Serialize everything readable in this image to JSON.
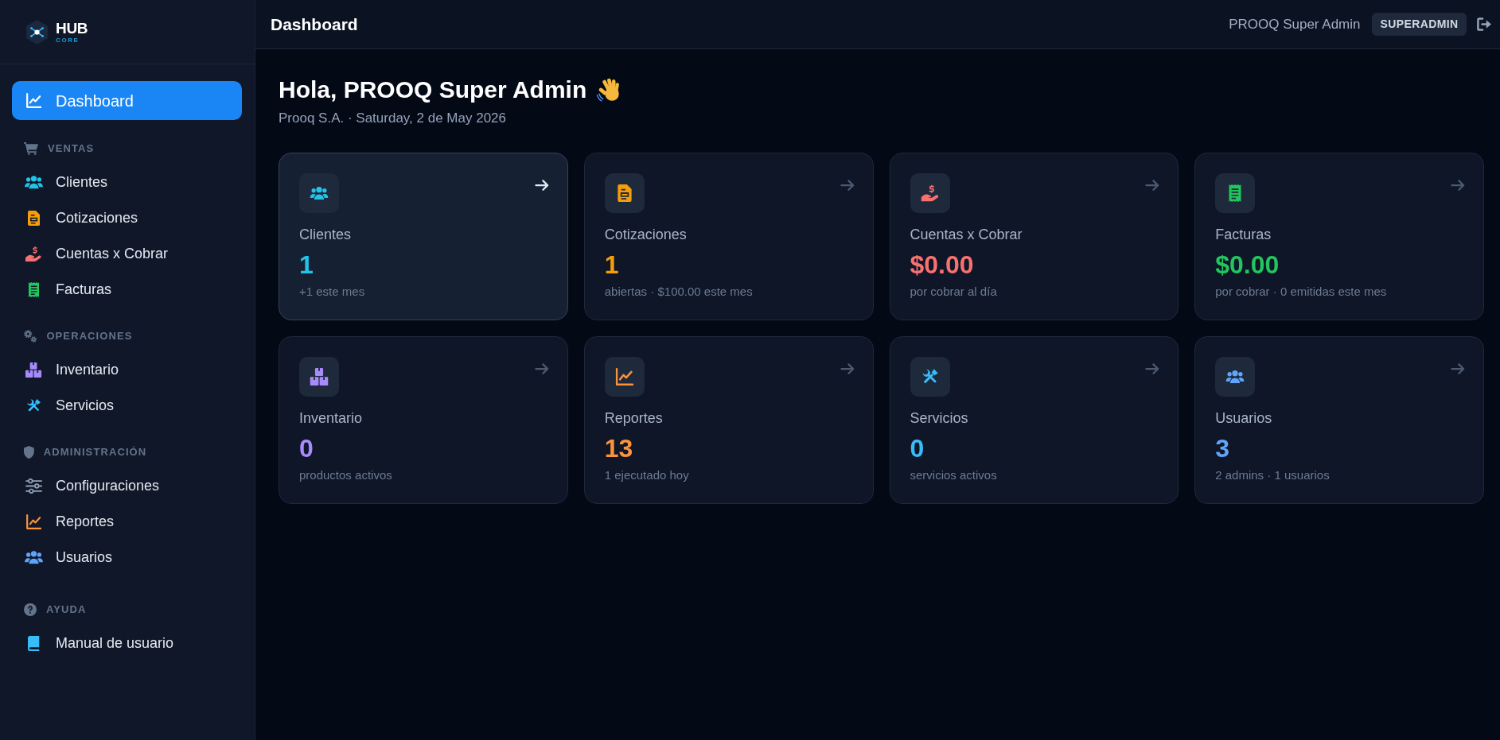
{
  "sidebar": {
    "brand": {
      "name": "HUB",
      "tagline": "CORE"
    },
    "items": [
      {
        "label": "Dashboard",
        "kind": "chart",
        "selected": true
      }
    ],
    "sections": [
      {
        "title": "VENTAS",
        "kind": "cart",
        "items": [
          {
            "label": "Clientes",
            "kind": "users",
            "color": "#22c3e6",
            "selected": false
          },
          {
            "label": "Cotizaciones",
            "kind": "document",
            "color": "#f59e0b",
            "selected": false
          },
          {
            "label": "Cuentas x Cobrar",
            "kind": "hand-dollar",
            "color": "#f87171",
            "selected": false
          },
          {
            "label": "Facturas",
            "kind": "receipt",
            "color": "#22c55e",
            "selected": false
          }
        ]
      },
      {
        "title": "OPERACIONES",
        "kind": "gears",
        "items": [
          {
            "label": "Inventario",
            "kind": "boxes",
            "color": "#a78bfa",
            "selected": false
          },
          {
            "label": "Servicios",
            "kind": "tools",
            "color": "#38bdf8",
            "selected": false
          }
        ]
      },
      {
        "title": "ADMINISTRACIÓN",
        "kind": "shield",
        "items": [
          {
            "label": "Configuraciones",
            "kind": "sliders",
            "color": "#94a3b8",
            "selected": false
          },
          {
            "label": "Reportes",
            "kind": "chart",
            "color": "#fb923c",
            "selected": false
          },
          {
            "label": "Usuarios",
            "kind": "users",
            "color": "#60a5fa",
            "selected": false
          }
        ]
      },
      {
        "title": "AYUDA",
        "kind": "help",
        "items": [
          {
            "label": "Manual de usuario",
            "kind": "book",
            "color": "#38bdf8",
            "selected": false
          }
        ]
      }
    ]
  },
  "header": {
    "title": "Dashboard",
    "user": "PROOQ Super Admin",
    "role": "SUPERADMIN"
  },
  "greeting": {
    "title": "Hola, PROOQ Super Admin",
    "subtitle": "Prooq S.A. · Saturday, 2 de May 2026"
  },
  "cards": [
    {
      "label": "Clientes",
      "value": "1",
      "note": "+1 este mes",
      "kind": "users",
      "color": "#22c3e6",
      "hovered": true
    },
    {
      "label": "Cotizaciones",
      "value": "1",
      "note": "abiertas · $100.00 este mes",
      "kind": "document",
      "color": "#f59e0b",
      "hovered": false
    },
    {
      "label": "Cuentas x Cobrar",
      "value": "$0.00",
      "note": "por cobrar al día",
      "kind": "hand-dollar",
      "color": "#f87171",
      "hovered": false
    },
    {
      "label": "Facturas",
      "value": "$0.00",
      "note": "por cobrar · 0 emitidas este mes",
      "kind": "receipt",
      "color": "#22c55e",
      "hovered": false
    },
    {
      "label": "Inventario",
      "value": "0",
      "note": "productos activos",
      "kind": "boxes",
      "color": "#a78bfa",
      "hovered": false
    },
    {
      "label": "Reportes",
      "value": "13",
      "note": "1 ejecutado hoy",
      "kind": "chart",
      "color": "#fb923c",
      "hovered": false
    },
    {
      "label": "Servicios",
      "value": "0",
      "note": "servicios activos",
      "kind": "tools",
      "color": "#38bdf8",
      "hovered": false
    },
    {
      "label": "Usuarios",
      "value": "3",
      "note": "2 admins · 1 usuarios",
      "kind": "users",
      "color": "#60a5fa",
      "hovered": false
    }
  ]
}
